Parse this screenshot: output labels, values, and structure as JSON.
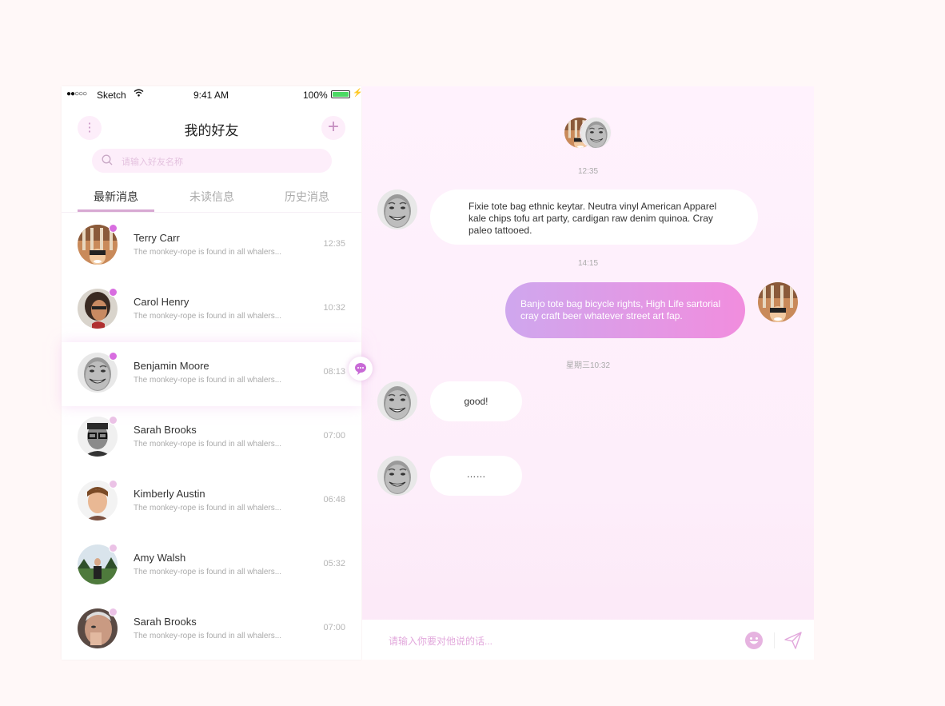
{
  "statusbar": {
    "signal": "●●○○○",
    "carrier": "Sketch",
    "time": "9:41 AM",
    "battery": "100%"
  },
  "header": {
    "title": "我的好友",
    "menu_icon": "⋮",
    "add_icon": "+"
  },
  "search": {
    "placeholder": "请输入好友名称"
  },
  "tabs": [
    {
      "label": "最新消息",
      "active": true
    },
    {
      "label": "未读信息",
      "active": false
    },
    {
      "label": "历史消息",
      "active": false
    }
  ],
  "contacts": [
    {
      "name": "Terry Carr",
      "preview": "The monkey-rope is found in all whalers...",
      "time": "12:35",
      "unread": true
    },
    {
      "name": "Carol Henry",
      "preview": "The monkey-rope is found in all whalers...",
      "time": "10:32",
      "unread": true
    },
    {
      "name": "Benjamin Moore",
      "preview": "The monkey-rope is found in all whalers...",
      "time": "08:13",
      "unread": true
    },
    {
      "name": "Sarah Brooks",
      "preview": "The monkey-rope is found in all whalers...",
      "time": "07:00",
      "unread": false
    },
    {
      "name": "Kimberly Austin",
      "preview": "The monkey-rope is found in all whalers...",
      "time": "06:48",
      "unread": false
    },
    {
      "name": "Amy Walsh",
      "preview": "The monkey-rope is found in all whalers...",
      "time": "05:32",
      "unread": false
    },
    {
      "name": "Sarah Brooks",
      "preview": "The monkey-rope is found in all whalers...",
      "time": "07:00",
      "unread": false
    }
  ],
  "chat": {
    "timestamps": [
      "12:35",
      "14:15",
      "星期三10:32"
    ],
    "messages": [
      {
        "from": "them",
        "text": "Fixie tote bag ethnic keytar. Neutra vinyl American Apparel kale chips tofu art party, cardigan raw denim quinoa. Cray paleo tattooed."
      },
      {
        "from": "me",
        "text": "Banjo tote bag bicycle rights, High Life sartorial cray craft beer whatever street art fap."
      },
      {
        "from": "them",
        "text": "good!"
      },
      {
        "from": "them",
        "text": "……"
      }
    ],
    "composer_placeholder": "请输入你要对他说的话..."
  },
  "colors": {
    "accent": "#d86de0",
    "accent_light": "#fdeefa",
    "bubble_me_start": "#cfa7ee",
    "bubble_me_end": "#f18dde"
  }
}
